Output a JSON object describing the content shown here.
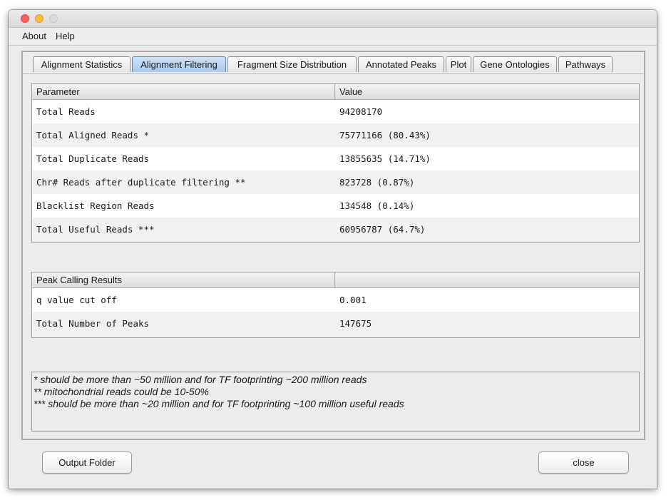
{
  "menubar": {
    "items": [
      "About",
      "Help"
    ]
  },
  "tabs": [
    {
      "label": "Alignment Statistics",
      "active": false
    },
    {
      "label": "Alignment Filtering",
      "active": true
    },
    {
      "label": "Fragment Size Distribution",
      "active": false
    },
    {
      "label": "Annotated Peaks",
      "active": false
    },
    {
      "label": "Plot",
      "active": false
    },
    {
      "label": "Gene Ontologies",
      "active": false
    },
    {
      "label": "Pathways",
      "active": false
    }
  ],
  "stats_table": {
    "headers": [
      "Parameter",
      "Value"
    ],
    "rows": [
      [
        "Total Reads",
        "94208170"
      ],
      [
        "Total Aligned Reads *",
        "75771166 (80.43%)"
      ],
      [
        "Total Duplicate Reads",
        "13855635 (14.71%)"
      ],
      [
        "Chr# Reads after duplicate filtering **",
        "823728 (0.87%)"
      ],
      [
        "Blacklist Region Reads",
        "134548 (0.14%)"
      ],
      [
        "Total Useful Reads ***",
        "60956787 (64.7%)"
      ]
    ]
  },
  "peak_table": {
    "headers": [
      "Peak Calling Results",
      ""
    ],
    "rows": [
      [
        "q value cut off",
        "0.001"
      ],
      [
        "Total Number of Peaks",
        "147675"
      ]
    ]
  },
  "notes": [
    "* should be more than ~50 million and for TF footprinting ~200 million reads",
    "** mitochondrial reads could be 10-50%",
    "*** should be more than ~20 million and for TF footprinting ~100 million useful reads"
  ],
  "buttons": {
    "output_folder": "Output Folder",
    "close": "close"
  },
  "colors": {
    "active_tab": "#a9c9ef",
    "close_red": "#fc605b",
    "minimize_yellow": "#fdbc40"
  }
}
